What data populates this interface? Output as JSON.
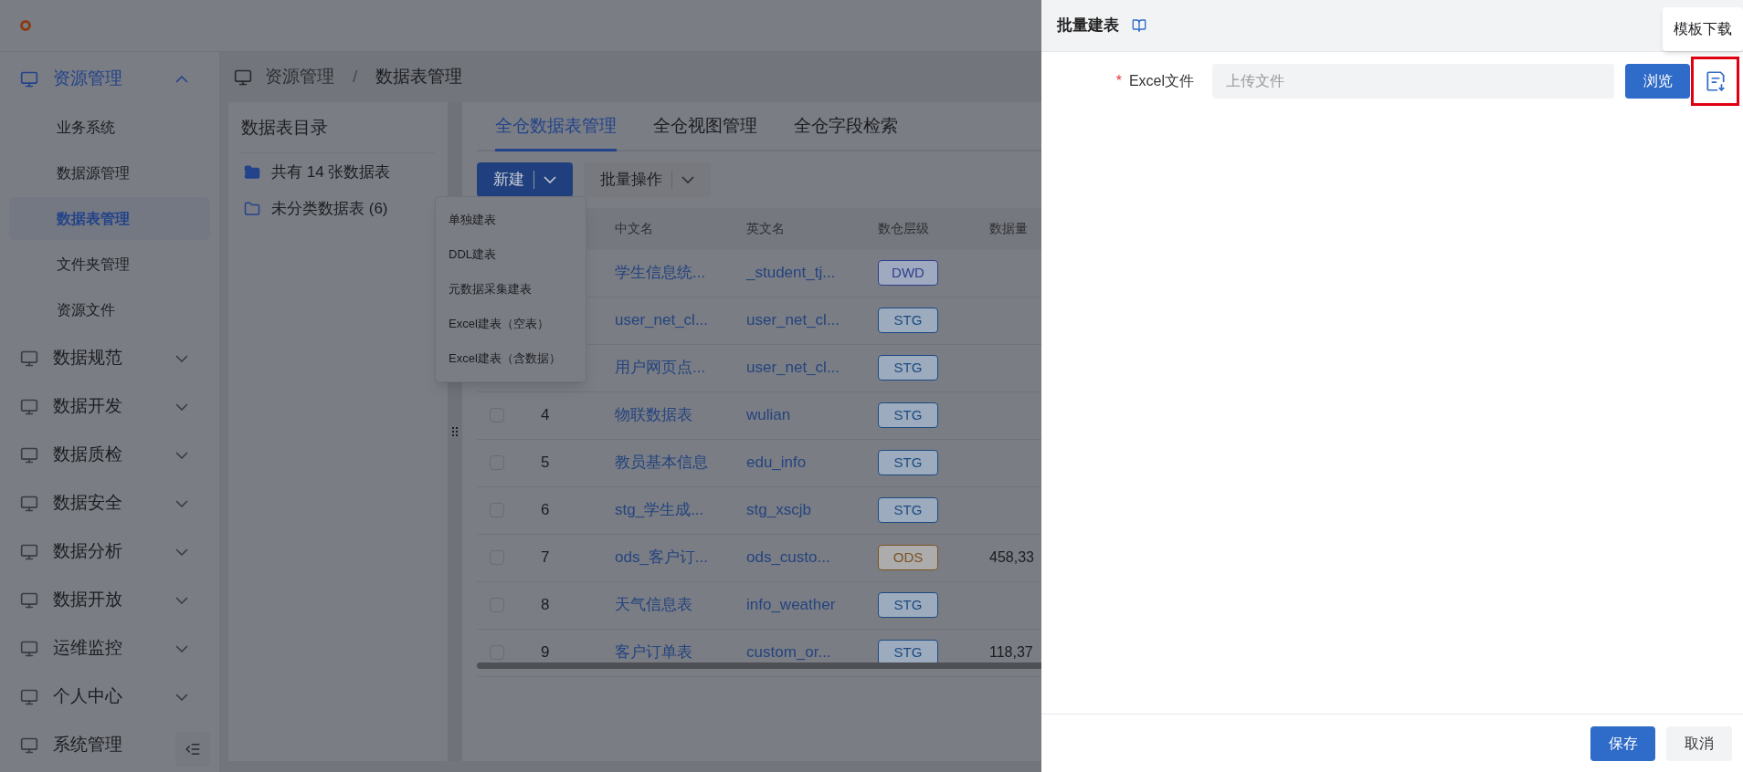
{
  "sidebar": {
    "groups": [
      {
        "label": "资源管理",
        "expanded": true,
        "children": [
          {
            "label": "业务系统",
            "selected": false
          },
          {
            "label": "数据源管理",
            "selected": false
          },
          {
            "label": "数据表管理",
            "selected": true
          },
          {
            "label": "文件夹管理",
            "selected": false
          },
          {
            "label": "资源文件",
            "selected": false
          }
        ]
      },
      {
        "label": "数据规范",
        "expanded": false
      },
      {
        "label": "数据开发",
        "expanded": false
      },
      {
        "label": "数据质检",
        "expanded": false
      },
      {
        "label": "数据安全",
        "expanded": false
      },
      {
        "label": "数据分析",
        "expanded": false
      },
      {
        "label": "数据开放",
        "expanded": false
      },
      {
        "label": "运维监控",
        "expanded": false
      },
      {
        "label": "个人中心",
        "expanded": false
      },
      {
        "label": "系统管理",
        "expanded": false
      }
    ]
  },
  "breadcrumb": [
    "资源管理",
    "/",
    "数据表管理"
  ],
  "catalog": {
    "title": "数据表目录",
    "items": [
      {
        "label": "共有 14 张数据表",
        "kind": "all"
      },
      {
        "label": "未分类数据表 (6)",
        "kind": "folder"
      }
    ]
  },
  "tabs": [
    {
      "label": "全仓数据表管理",
      "selected": true
    },
    {
      "label": "全仓视图管理",
      "selected": false
    },
    {
      "label": "全仓字段检索",
      "selected": false
    }
  ],
  "toolbar": {
    "new_button": "新建",
    "batch_button": "批量操作"
  },
  "new_menu": [
    "单独建表",
    "DDL建表",
    "元数据采集建表",
    "Excel建表（空表）",
    "Excel建表（含数据）"
  ],
  "table": {
    "columns": [
      "中文名",
      "英文名",
      "数仓层级",
      "数据量"
    ],
    "rows": [
      {
        "cn": "学生信息统...",
        "en": "_student_tj...",
        "layer": "DWD",
        "color": "#2f3f8c"
      },
      {
        "cn": "user_net_cl...",
        "en": "user_net_cl...",
        "layer": "STG",
        "color": "#1d4a80"
      },
      {
        "cn": "用户网页点...",
        "en": "user_net_cl...",
        "layer": "STG",
        "color": "#1d4a80"
      },
      {
        "checked": false,
        "index": "4",
        "cn": "物联数据表",
        "en": "wulian",
        "layer": "STG",
        "color": "#1d4a80"
      },
      {
        "checked": false,
        "index": "5",
        "cn": "教员基本信息",
        "en": "edu_info",
        "layer": "STG",
        "color": "#1d4a80"
      },
      {
        "checked": false,
        "index": "6",
        "cn": "stg_学生成...",
        "en": "stg_xscjb",
        "layer": "STG",
        "color": "#1d4a80"
      },
      {
        "checked": false,
        "index": "7",
        "cn": "ods_客户订...",
        "en": "ods_custo...",
        "layer": "ODS",
        "color": "#7a5222",
        "count": "458,33"
      },
      {
        "checked": false,
        "index": "8",
        "cn": "天气信息表",
        "en": "info_weather",
        "layer": "STG",
        "color": "#1d4a80"
      },
      {
        "checked": false,
        "index": "9",
        "cn": "客户订单表",
        "en": "custom_or...",
        "layer": "STG",
        "color": "#1d4a80",
        "count": "118,37"
      }
    ]
  },
  "drawer": {
    "title": "批量建表",
    "required_mark": "*",
    "field_label": "Excel文件",
    "field_placeholder": "上传文件",
    "browse_button": "浏览",
    "tooltip": "模板下载",
    "save_button": "保存",
    "cancel_button": "取消"
  }
}
